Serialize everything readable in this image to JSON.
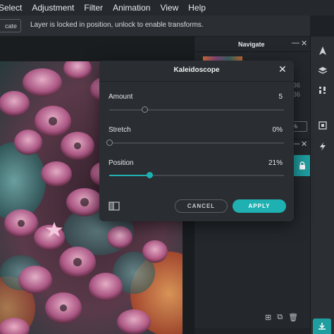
{
  "menu": [
    "Select",
    "Adjustment",
    "Filter",
    "Animation",
    "View",
    "Help"
  ],
  "options_bar": {
    "button_label": "cate",
    "message": "Layer is locked in position, unlock to enable transforms."
  },
  "navigate_panel": {
    "title": "Navigate",
    "minimize": "—",
    "close": "✕",
    "num1": "36",
    "num2": "36",
    "zoom": "%"
  },
  "layers_panel": {
    "minimize": "—",
    "close": "✕"
  },
  "dialog": {
    "title": "Kaleidoscope",
    "close": "✕",
    "params": [
      {
        "label": "Amount",
        "value": "5",
        "level": 0.2
      },
      {
        "label": "Stretch",
        "value": "0%",
        "level": 0.0
      },
      {
        "label": "Position",
        "value": "21%",
        "level": 0.23
      }
    ],
    "cancel_label": "CANCEL",
    "apply_label": "APPLY"
  },
  "colors": {
    "accent": "#1fb0b2",
    "background": "#1e2226",
    "panel": "#2a2e32"
  },
  "icons": [
    "arrow-cursor-icon",
    "layers-icon",
    "adjust-icon",
    "crop-icon",
    "magic-icon",
    "download-icon",
    "lock-icon",
    "add-layer-icon",
    "duplicate-icon",
    "delete-icon",
    "compare-icon"
  ]
}
